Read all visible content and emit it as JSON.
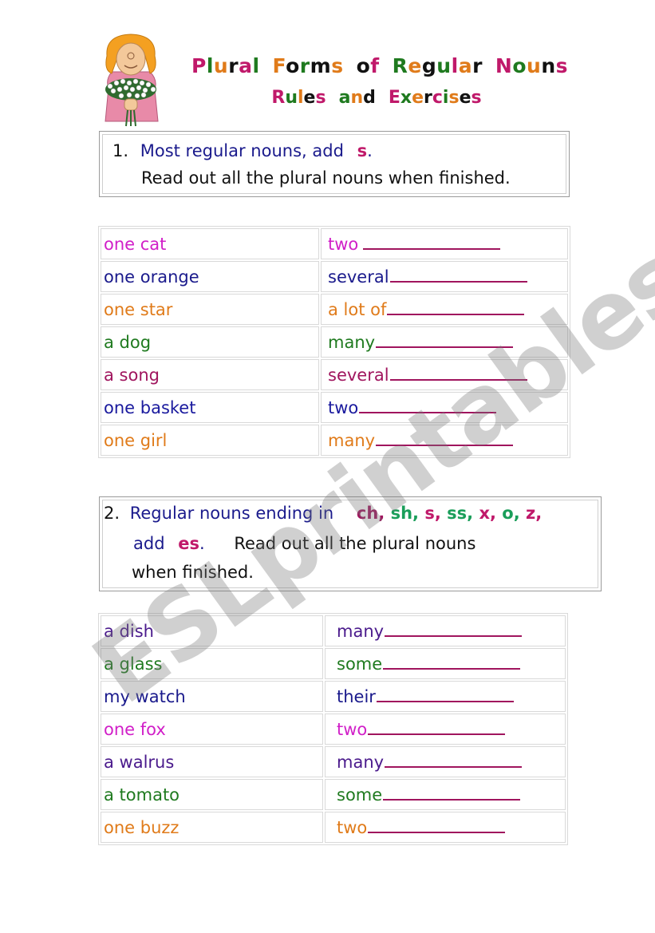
{
  "header": {
    "title_words": [
      {
        "letters": [
          [
            "P",
            "#c0196a"
          ],
          [
            "l",
            "#1f7a1f"
          ],
          [
            "u",
            "#e07b1a"
          ],
          [
            "r",
            "#111111"
          ],
          [
            "a",
            "#c0196a"
          ],
          [
            "l",
            "#1f7a1f"
          ]
        ]
      },
      {
        "letters": [
          [
            "F",
            "#e07b1a"
          ],
          [
            "o",
            "#111111"
          ],
          [
            "r",
            "#1f7a1f"
          ],
          [
            "m",
            "#111111"
          ],
          [
            "s",
            "#e07b1a"
          ]
        ]
      },
      {
        "letters": [
          [
            "o",
            "#111111"
          ],
          [
            "f",
            "#c0196a"
          ]
        ]
      },
      {
        "letters": [
          [
            "R",
            "#1f7a1f"
          ],
          [
            "e",
            "#e07b1a"
          ],
          [
            "g",
            "#111111"
          ],
          [
            "u",
            "#1f7a1f"
          ],
          [
            "l",
            "#c0196a"
          ],
          [
            "a",
            "#e07b1a"
          ],
          [
            "r",
            "#111111"
          ]
        ]
      },
      {
        "letters": [
          [
            "N",
            "#c0196a"
          ],
          [
            "o",
            "#1f7a1f"
          ],
          [
            "u",
            "#e07b1a"
          ],
          [
            "n",
            "#111111"
          ],
          [
            "s",
            "#c0196a"
          ]
        ]
      }
    ],
    "subtitle_words": [
      {
        "letters": [
          [
            "R",
            "#c0196a"
          ],
          [
            "u",
            "#1f7a1f"
          ],
          [
            "l",
            "#e07b1a"
          ],
          [
            "e",
            "#111111"
          ],
          [
            "s",
            "#c0196a"
          ]
        ]
      },
      {
        "letters": [
          [
            "a",
            "#1f7a1f"
          ],
          [
            "n",
            "#e07b1a"
          ],
          [
            "d",
            "#111111"
          ]
        ]
      },
      {
        "letters": [
          [
            "E",
            "#c0196a"
          ],
          [
            "x",
            "#1f7a1f"
          ],
          [
            "e",
            "#e07b1a"
          ],
          [
            "r",
            "#111111"
          ],
          [
            "c",
            "#c0196a"
          ],
          [
            "i",
            "#1f7a1f"
          ],
          [
            "s",
            "#e07b1a"
          ],
          [
            "e",
            "#111111"
          ],
          [
            "s",
            "#c0196a"
          ]
        ]
      }
    ],
    "clipart": "girl-with-flowers-icon"
  },
  "rule1": {
    "number": "1.",
    "text": "Most regular nouns, add",
    "ending": "s",
    "period": ".",
    "instruction": "Read out all the plural nouns when finished."
  },
  "exercise1": {
    "rows": [
      {
        "singular": "one cat",
        "prompt": "two",
        "color": "#d11fc8"
      },
      {
        "singular": "one orange",
        "prompt": "several",
        "color": "#1a1a8c"
      },
      {
        "singular": "one star",
        "prompt": "a lot of",
        "color": "#e07b1a"
      },
      {
        "singular": "a dog",
        "prompt": "many",
        "color": "#1f7a1f"
      },
      {
        "singular": "a song",
        "prompt": "several",
        "color": "#a0155e"
      },
      {
        "singular": "one basket",
        "prompt": "two",
        "color": "#1a1a9e"
      },
      {
        "singular": "one girl",
        "prompt": "many",
        "color": "#e07b1a"
      }
    ]
  },
  "rule2": {
    "number": "2.",
    "text": "Regular  nouns ending in",
    "endings": [
      {
        "text": "ch",
        "color": "#a0155e"
      },
      {
        "text": "sh",
        "color": "#1a9e5a"
      },
      {
        "text": "s",
        "color": "#c0196a"
      },
      {
        "text": "ss",
        "color": "#1a9e5a"
      },
      {
        "text": "x",
        "color": "#c0196a"
      },
      {
        "text": "o",
        "color": "#1a9e5a"
      },
      {
        "text": "z",
        "color": "#c0196a"
      }
    ],
    "add": "add",
    "ending": "es",
    "period": ".",
    "instruction_a": "Read out all the plural nouns",
    "instruction_b": "when finished."
  },
  "exercise2": {
    "rows": [
      {
        "singular": "a dish",
        "prompt": "many",
        "color": "#4a1a8c"
      },
      {
        "singular": "a glass",
        "prompt": "some",
        "color": "#1f7a1f"
      },
      {
        "singular": "my watch",
        "prompt": "their",
        "color": "#1a1a8c"
      },
      {
        "singular": "one fox",
        "prompt": "two",
        "color": "#d11fc8"
      },
      {
        "singular": "a walrus",
        "prompt": "many",
        "color": "#4a1a8c"
      },
      {
        "singular": "a tomato",
        "prompt": "some",
        "color": "#1f7a1f"
      },
      {
        "singular": "one buzz",
        "prompt": "two",
        "color": "#e07b1a"
      }
    ]
  },
  "watermark": "ESLprintables.com",
  "colors": {
    "blank_line": "#a0155e",
    "cell_border": "#d9d9d9",
    "box_border": "#9a9a9a"
  }
}
